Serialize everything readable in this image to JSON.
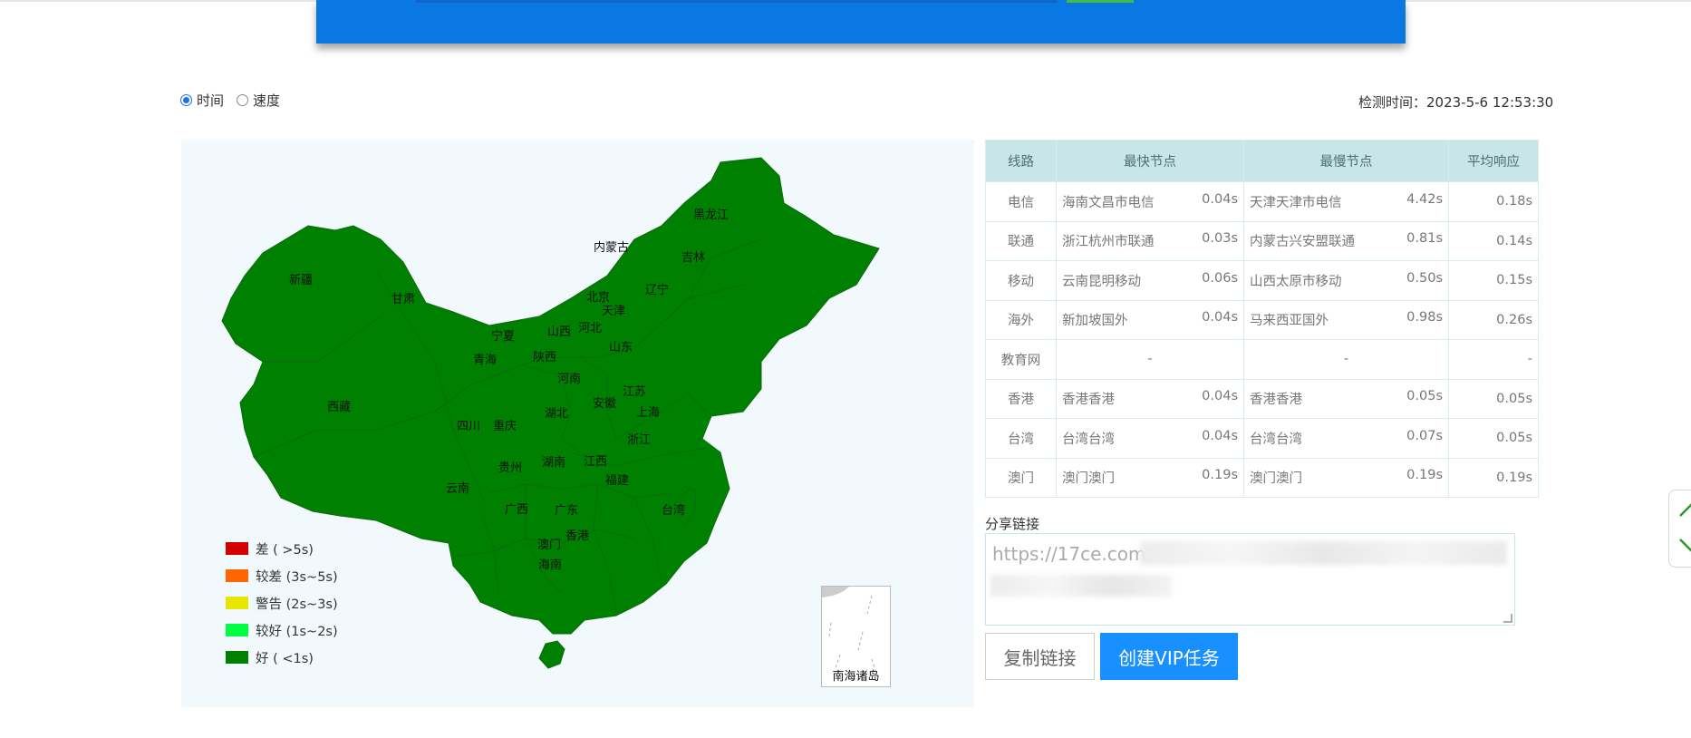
{
  "radios": {
    "time_label": "时间",
    "speed_label": "速度",
    "selected": "时间"
  },
  "check_time": "检测时间：2023-5-6 12:53:30",
  "map": {
    "provinces": [
      "黑龙江",
      "吉林",
      "内蒙古",
      "辽宁",
      "北京",
      "天津",
      "河北",
      "新疆",
      "甘肃",
      "宁夏",
      "山西",
      "山东",
      "青海",
      "陕西",
      "河南",
      "江苏",
      "西藏",
      "安徽",
      "上海",
      "四川",
      "重庆",
      "湖北",
      "浙江",
      "贵州",
      "湖南",
      "江西",
      "福建",
      "云南",
      "广西",
      "广东",
      "台湾",
      "香港",
      "澳门",
      "海南"
    ],
    "south_sea_label": "南海诸岛",
    "fill_color": "#008000"
  },
  "legend": [
    {
      "label": "差 ( >5s)",
      "color": "#d40000"
    },
    {
      "label": "较差 (3s~5s)",
      "color": "#ff6600"
    },
    {
      "label": "警告 (2s~3s)",
      "color": "#e6e600"
    },
    {
      "label": "较好 (1s~2s)",
      "color": "#00ff44"
    },
    {
      "label": "好 ( <1s)",
      "color": "#008000"
    }
  ],
  "table": {
    "headers": [
      "线路",
      "最快节点",
      "最慢节点",
      "平均响应"
    ],
    "rows": [
      {
        "line": "电信",
        "fast_node": "海南文昌市电信",
        "fast_time": "0.04s",
        "slow_node": "天津天津市电信",
        "slow_time": "4.42s",
        "avg": "0.18s"
      },
      {
        "line": "联通",
        "fast_node": "浙江杭州市联通",
        "fast_time": "0.03s",
        "slow_node": "内蒙古兴安盟联通",
        "slow_time": "0.81s",
        "avg": "0.14s"
      },
      {
        "line": "移动",
        "fast_node": "云南昆明移动",
        "fast_time": "0.06s",
        "slow_node": "山西太原市移动",
        "slow_time": "0.50s",
        "avg": "0.15s"
      },
      {
        "line": "海外",
        "fast_node": "新加坡国外",
        "fast_time": "0.04s",
        "slow_node": "马来西亚国外",
        "slow_time": "0.98s",
        "avg": "0.26s"
      },
      {
        "line": "教育网",
        "fast_node": "-",
        "fast_time": "",
        "slow_node": "-",
        "slow_time": "",
        "avg": "-"
      },
      {
        "line": "香港",
        "fast_node": "香港香港",
        "fast_time": "0.04s",
        "slow_node": "香港香港",
        "slow_time": "0.05s",
        "avg": "0.05s"
      },
      {
        "line": "台湾",
        "fast_node": "台湾台湾",
        "fast_time": "0.04s",
        "slow_node": "台湾台湾",
        "slow_time": "0.07s",
        "avg": "0.05s"
      },
      {
        "line": "澳门",
        "fast_node": "澳门澳门",
        "fast_time": "0.19s",
        "slow_node": "澳门澳门",
        "slow_time": "0.19s",
        "avg": "0.19s"
      }
    ]
  },
  "share": {
    "label": "分享链接",
    "value": "https://17ce.com/"
  },
  "buttons": {
    "copy": "复制链接",
    "vip": "创建VIP任务"
  },
  "icons": {
    "scroll_up": "chevron-up-icon",
    "scroll_down": "chevron-down-icon"
  }
}
